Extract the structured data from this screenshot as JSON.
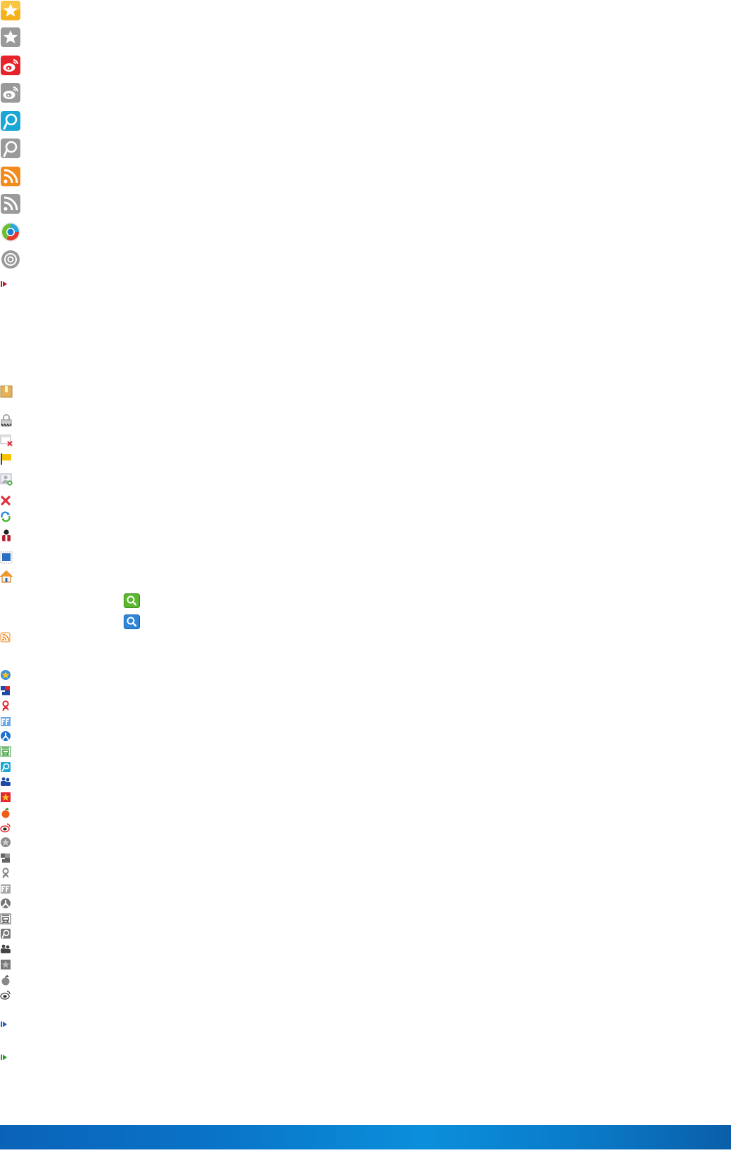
{
  "sprite_sheet": {
    "large_icons": [
      {
        "name": "star-icon",
        "state": "color"
      },
      {
        "name": "star-icon",
        "state": "gray"
      },
      {
        "name": "weibo-icon",
        "state": "color"
      },
      {
        "name": "weibo-icon",
        "state": "gray"
      },
      {
        "name": "p-logo-icon",
        "state": "color"
      },
      {
        "name": "p-logo-icon",
        "state": "gray"
      },
      {
        "name": "rss-icon",
        "state": "color"
      },
      {
        "name": "rss-icon",
        "state": "gray"
      },
      {
        "name": "tencent-icon",
        "state": "color"
      },
      {
        "name": "tencent-icon",
        "state": "gray"
      }
    ],
    "toolbar_icons": [
      "package-icon",
      "lock-icon",
      "window-close-icon",
      "flag-icon",
      "add-user-icon",
      "close-icon",
      "refresh-icon",
      "user-icon",
      "window-icon",
      "home-icon"
    ],
    "search_buttons": [
      {
        "name": "search-button-green",
        "color": "#5bb82e"
      },
      {
        "name": "search-button-blue",
        "color": "#2f86d8"
      }
    ],
    "share_icons_color": [
      "star-circle-icon",
      "renren-icon",
      "kaixin-icon",
      "ff-icon",
      "people-icon",
      "douban-icon",
      "p-small-icon",
      "group-icon",
      "star-square-icon",
      "apple-icon",
      "weibo-small-icon"
    ],
    "share_icons_gray": [
      "star-circle-icon",
      "renren-icon",
      "kaixin-icon",
      "ff-icon",
      "people-icon",
      "douban-icon",
      "p-small-icon",
      "group-icon",
      "star-square-icon",
      "apple-icon",
      "weibo-small-icon"
    ],
    "colors": {
      "star": "#f6b21b",
      "weibo": "#e6232b",
      "p_logo": "#1aa7d6",
      "rss": "#f28a1c",
      "gray": "#9a9a9a",
      "arrow_red": "#b5212e",
      "arrow_blue": "#1f5fd0",
      "arrow_green": "#2f9a2a",
      "bar": "#0a78c6"
    }
  }
}
